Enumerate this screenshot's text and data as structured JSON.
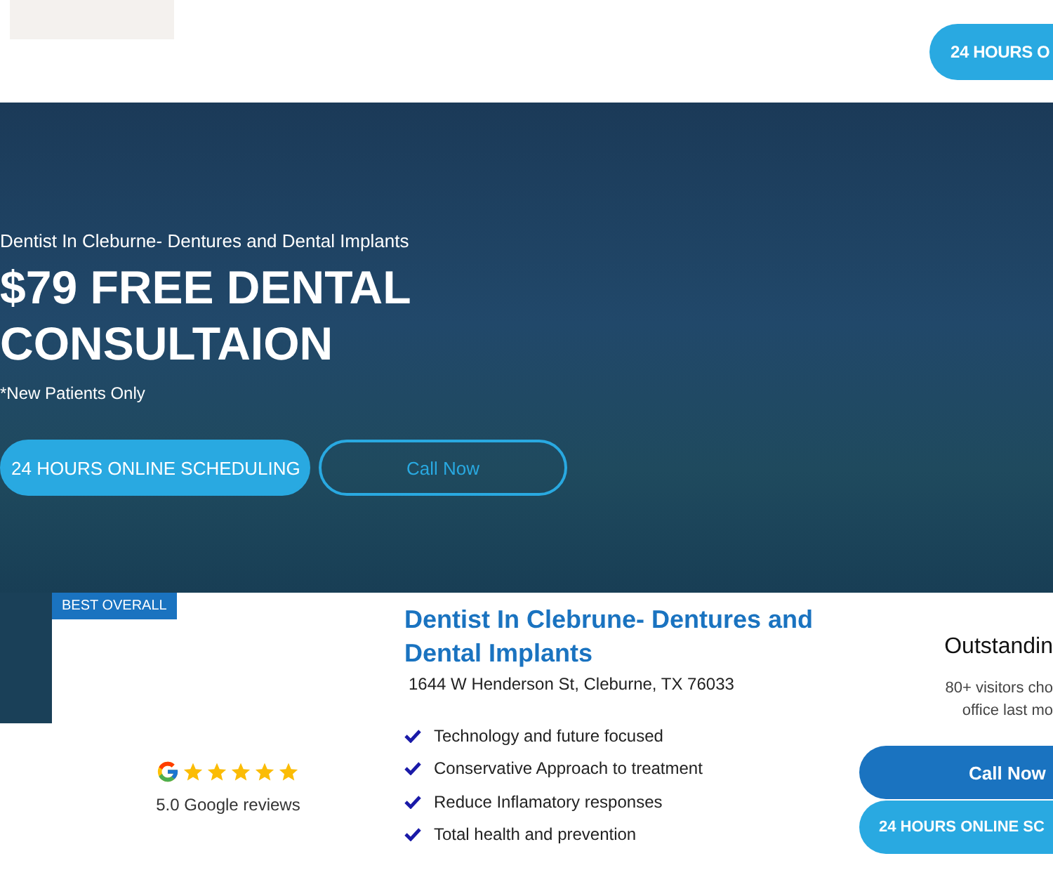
{
  "header": {
    "button": "24 HOURS O"
  },
  "hero": {
    "subtitle": "Dentist In Cleburne- Dentures and Dental Implants",
    "headline_lines": [
      "$79 FREE DENTAL",
      "CONSULTAION"
    ],
    "note": "*New Patients Only",
    "buttons": [
      {
        "kind": "filled",
        "label": "24 HOURS ONLINE SCHEDULING"
      },
      {
        "kind": "outline",
        "label": "Call Now"
      }
    ]
  },
  "card": {
    "badge": "BEST OVERALL",
    "rating": {
      "stars": 5,
      "label": "5.0 Google reviews"
    },
    "title": "Dentist In Clebrune- Dentures and Dental  Implants",
    "address": "1644 W Henderson St, Cleburne, TX 76033",
    "features": [
      "Technology and future focused",
      "Conservative Approach to treatment",
      "Reduce Inflamatory responses",
      "Total health and prevention"
    ],
    "side": {
      "heading": "Outstandin",
      "text_lines": [
        "80+ visitors cho",
        "office last mo"
      ],
      "buttons": [
        {
          "kind": "dark",
          "label": "Call Now"
        },
        {
          "kind": "light",
          "label": "24 HOURS ONLINE SC"
        }
      ]
    }
  }
}
